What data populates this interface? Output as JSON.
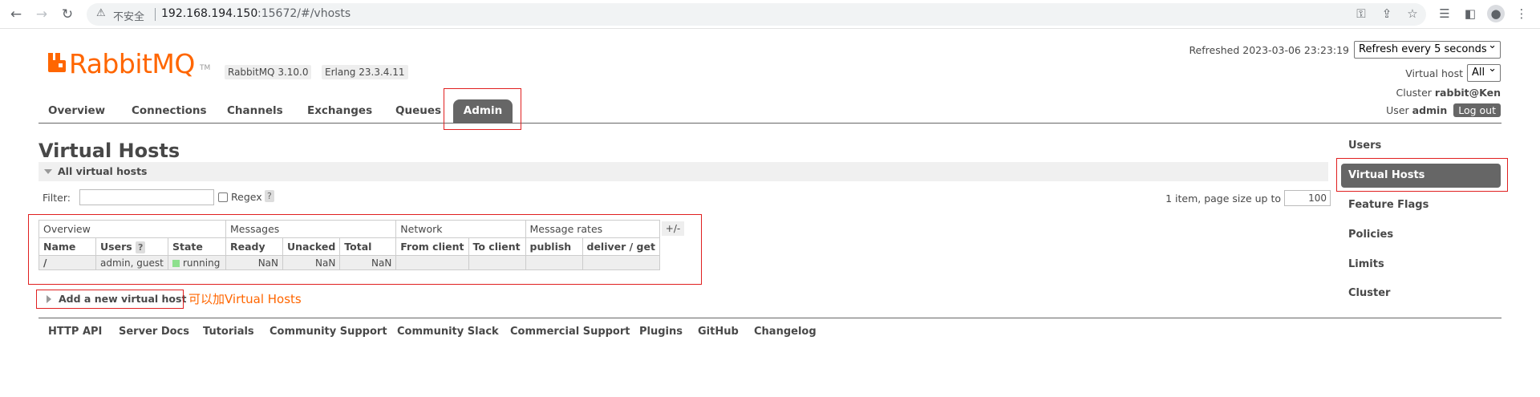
{
  "browser": {
    "back": "←",
    "forward": "→",
    "reload": "↻",
    "warning_icon": "⚠",
    "insecure": "不安全",
    "url_host": "192.168.194.150",
    "url_rest": ":15672/#/vhosts",
    "icons": [
      "key-icon",
      "share-icon",
      "star-icon",
      "reading-list-icon",
      "side-panel-icon",
      "profile-icon",
      "menu-icon"
    ]
  },
  "header": {
    "logo_text": "RabbitMQ",
    "logo_tm": "TM",
    "version": "RabbitMQ 3.10.0",
    "erlang": "Erlang 23.3.4.11",
    "refreshed": "Refreshed 2023-03-06 23:23:19",
    "refresh_option": "Refresh every 5 seconds",
    "vhost_label": "Virtual host",
    "vhost_option": "All",
    "cluster_label": "Cluster",
    "cluster_value": "rabbit@Ken",
    "user_label": "User",
    "user_value": "admin",
    "logout": "Log out"
  },
  "nav": {
    "tabs": [
      "Overview",
      "Connections",
      "Channels",
      "Exchanges",
      "Queues",
      "Admin"
    ],
    "active": "Admin"
  },
  "main": {
    "title": "Virtual Hosts",
    "section": "All virtual hosts",
    "filter_label": "Filter:",
    "filter_value": "",
    "regex_label": "Regex",
    "help": "?",
    "page_info": "1 item, page size up to",
    "page_size": "100",
    "plusminus": "+/-",
    "table": {
      "groups": [
        "Overview",
        "Messages",
        "Network",
        "Message rates"
      ],
      "columns": [
        "Name",
        "Users",
        "State",
        "Ready",
        "Unacked",
        "Total",
        "From client",
        "To client",
        "publish",
        "deliver / get"
      ],
      "rows": [
        {
          "name": "/",
          "users": "admin, guest",
          "state": "running",
          "ready": "NaN",
          "unacked": "NaN",
          "total": "NaN",
          "from_client": "",
          "to_client": "",
          "publish": "",
          "deliver_get": ""
        }
      ]
    },
    "add_vhost": "Add a new virtual host",
    "annotation": "可以加Virtual Hosts"
  },
  "sidebar": {
    "items": [
      "Users",
      "Virtual Hosts",
      "Feature Flags",
      "Policies",
      "Limits",
      "Cluster"
    ],
    "active": "Virtual Hosts"
  },
  "footer": {
    "links": [
      "HTTP API",
      "Server Docs",
      "Tutorials",
      "Community Support",
      "Community Slack",
      "Commercial Support",
      "Plugins",
      "GitHub",
      "Changelog"
    ]
  },
  "colors": {
    "brand": "#ff6600",
    "active_tab": "#666666",
    "highlight": "#e02020",
    "running": "#8ee08e"
  }
}
